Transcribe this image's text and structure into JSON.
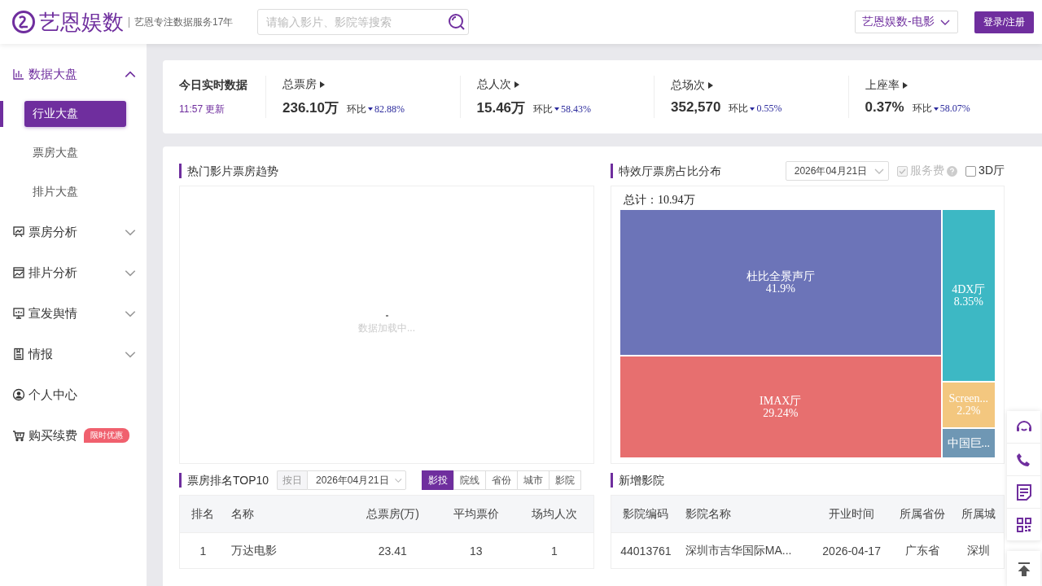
{
  "header": {
    "logo": "艺恩娱数",
    "slogan": "艺恩专注数据服务17年",
    "search": {
      "placeholder": "请输入影片、影院等搜索"
    },
    "product_select": "艺恩娱数-电影",
    "login_button": "登录/注册"
  },
  "sidebar": {
    "items": [
      {
        "kind": "group",
        "label": "数据大盘",
        "expanded": true,
        "children": [
          {
            "label": "行业大盘",
            "selected": true
          },
          {
            "label": "票房大盘",
            "selected": false
          },
          {
            "label": "排片大盘",
            "selected": false
          }
        ]
      },
      {
        "kind": "group",
        "label": "票房分析",
        "expanded": false
      },
      {
        "kind": "group",
        "label": "排片分析",
        "expanded": false
      },
      {
        "kind": "group",
        "label": "宣发舆情",
        "expanded": false
      },
      {
        "kind": "group",
        "label": "情报",
        "expanded": false
      },
      {
        "kind": "link",
        "label": "个人中心"
      },
      {
        "kind": "link",
        "label": "购买续费",
        "badge": "限时优惠"
      }
    ]
  },
  "realtime": {
    "title": "今日实时数据",
    "updated": "11:57 更新",
    "metrics": [
      {
        "label": "总票房",
        "value": "236.10万",
        "ratio_label": "环比",
        "change": "82.88%"
      },
      {
        "label": "总人次",
        "value": "15.46万",
        "ratio_label": "环比",
        "change": "58.43%"
      },
      {
        "label": "总场次",
        "value": "352,570",
        "ratio_label": "环比",
        "change": "0.55%"
      },
      {
        "label": "上座率",
        "value": "0.37%",
        "ratio_label": "环比",
        "change": "58.07%"
      }
    ]
  },
  "trend": {
    "title": "热门影片票房趋势",
    "loading_text": "数据加载中..."
  },
  "special_halls": {
    "title": "特效厅票房占比分布",
    "date": "2026年04月21日",
    "service_fee": {
      "label": "服务费",
      "checked": true,
      "disabled": true
    },
    "hall_3d": {
      "label": "3D厅",
      "checked": false,
      "disabled": false
    },
    "total": "总计：10.94万",
    "columns": [
      {
        "tiles": [
          {
            "label": "杜比全景声厅",
            "share": "41.9%",
            "color": "#6c74b8"
          },
          {
            "label": "IMAX厅",
            "share": "29.24%",
            "color": "#e76f6f"
          }
        ]
      },
      {
        "tiles": [
          {
            "label": "4DX厅",
            "share": "8.35%",
            "color": "#3db8c4"
          },
          {
            "label": "Screen...",
            "share": "2.2%",
            "color": "#f3c77f"
          },
          {
            "label": "中国巨...",
            "color": "#6f97b4"
          }
        ]
      }
    ]
  },
  "ranking": {
    "title": "票房排名TOP10",
    "period": "按日",
    "date": "2026年04月21日",
    "tabs": [
      {
        "label": "影投",
        "selected": true
      },
      {
        "label": "院线",
        "selected": false
      },
      {
        "label": "省份",
        "selected": false
      },
      {
        "label": "城市",
        "selected": false
      },
      {
        "label": "影院",
        "selected": false
      }
    ],
    "columns": [
      "排名",
      "名称",
      "总票房(万)",
      "平均票价",
      "场均人次"
    ],
    "rows": [
      [
        "1",
        "万达电影",
        "23.41",
        "13",
        "1"
      ]
    ]
  },
  "new_cinemas": {
    "title": "新增影院",
    "columns": [
      "影院编码",
      "影院名称",
      "开业时间",
      "所属省份",
      "所属城"
    ],
    "rows": [
      [
        "44013761",
        "深圳市吉华国际MA...",
        "2026-04-17",
        "广东省",
        "深圳"
      ]
    ]
  }
}
